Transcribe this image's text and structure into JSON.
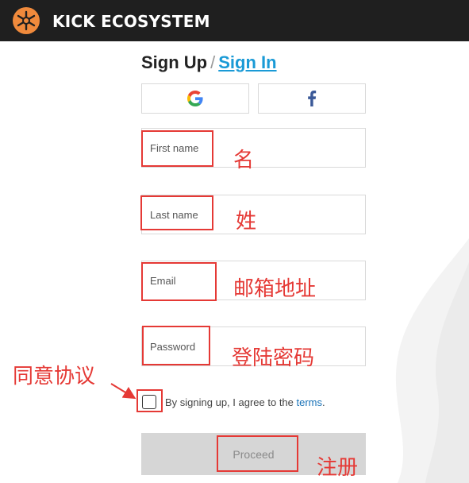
{
  "header": {
    "brand": "KICK ECOSYSTEM",
    "logo_icon": "kick-logo-icon",
    "logo_color": "#f08a3c",
    "background": "#1f1f1f"
  },
  "heading": {
    "sign_up": "Sign Up",
    "separator": "/",
    "sign_in": "Sign In"
  },
  "social": {
    "google_icon": "google-g-icon",
    "facebook_icon": "facebook-f-icon"
  },
  "form": {
    "first_name_placeholder": "First name",
    "last_name_placeholder": "Last name",
    "email_placeholder": "Email",
    "password_placeholder": "Password",
    "agree_prefix": "By signing up, I agree to the ",
    "terms_link": "terms",
    "agree_suffix": ".",
    "proceed_label": "Proceed"
  },
  "annotations": {
    "first_name": "名",
    "last_name": "姓",
    "email": "邮箱地址",
    "password": "登陆密码",
    "agree": "同意协议",
    "register": "注册",
    "color": "#e53935"
  },
  "colors": {
    "link": "#1a9ad6",
    "button_disabled": "#d6d6d6"
  }
}
